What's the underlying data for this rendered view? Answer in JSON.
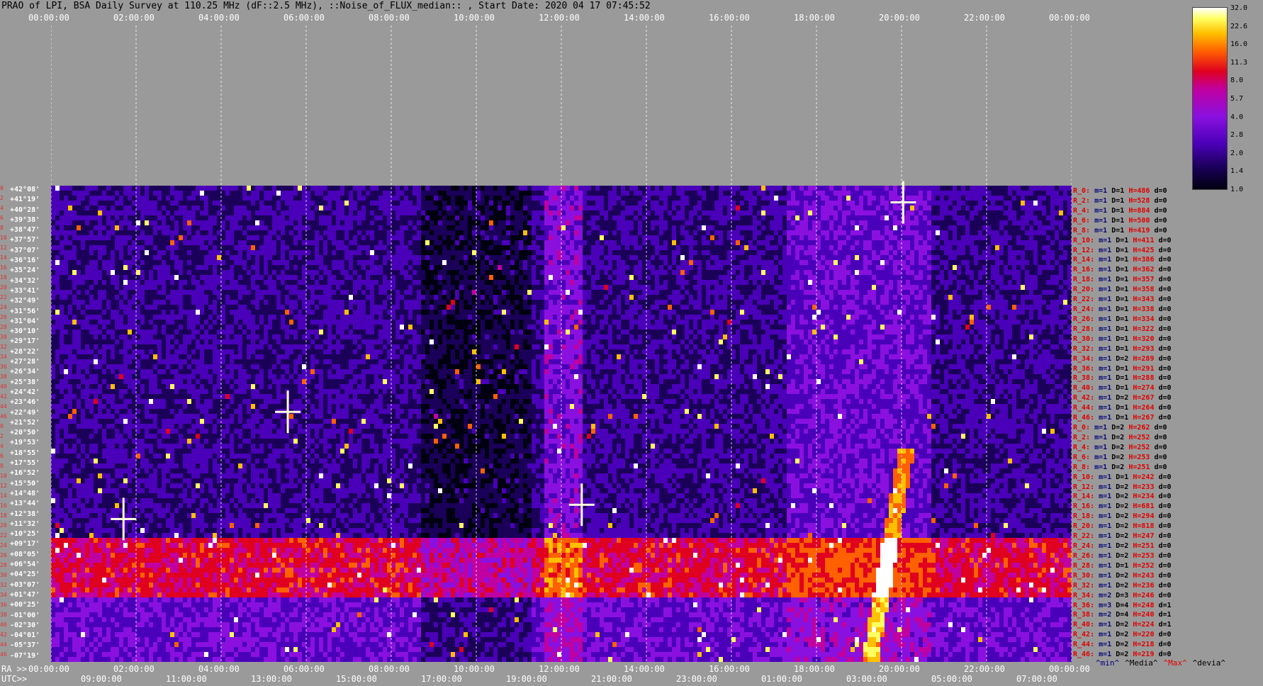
{
  "title": "PRAO of LPI, BSA Daily Survey at 110.25 MHz (dF::2.5 MHz), ::Noise_of_FLUX_median:: , Start Date: 2020 04 17 07:45:52",
  "top_axis_ticks": [
    "00:00:00",
    "02:00:00",
    "04:00:00",
    "06:00:00",
    "08:00:00",
    "10:00:00",
    "12:00:00",
    "14:00:00",
    "16:00:00",
    "18:00:00",
    "20:00:00",
    "22:00:00",
    "00:00:00"
  ],
  "bottom_ra_label": "RA >>",
  "bottom_ra_ticks": [
    "00:00:00",
    "02:00:00",
    "04:00:00",
    "06:00:00",
    "08:00:00",
    "10:00:00",
    "12:00:00",
    "14:00:00",
    "16:00:00",
    "18:00:00",
    "20:00:00",
    "22:00:00",
    "00:00:00"
  ],
  "bottom_utc_label": "UTC>>",
  "bottom_utc_ticks": [
    "09:00:00",
    "11:00:00",
    "13:00:00",
    "15:00:00",
    "17:00:00",
    "19:00:00",
    "21:00:00",
    "23:00:00",
    "01:00:00",
    "03:00:00",
    "05:00:00",
    "07:00:00"
  ],
  "dec_labels": [
    "+42°08'",
    "+41°19'",
    "+40°28'",
    "+39°38'",
    "+38°47'",
    "+37°57'",
    "+37°07'",
    "+36°16'",
    "+35°24'",
    "+34°32'",
    "+33°41'",
    "+32°49'",
    "+31°56'",
    "+31°04'",
    "+30°10'",
    "+29°17'",
    "+28°22'",
    "+27°28'",
    "+26°34'",
    "+25°38'",
    "+24°42'",
    "+23°46'",
    "+22°49'",
    "+21°52'",
    "+20°50'",
    "+19°53'",
    "+18°55'",
    "+17°55'",
    "+16°52'",
    "+15°50'",
    "+14°48'",
    "+13°44'",
    "+12°38'",
    "+11°32'",
    "+10°25'",
    "+09°17'",
    "+08°05'",
    "+06°54'",
    "+04°25'",
    "+03°07'",
    "+01°47'",
    "+00°25'",
    "-01°00'",
    "-02°30'",
    "-04°01'",
    "-05°37'",
    "-07°19'"
  ],
  "row_numbers": [
    "0",
    "2",
    "4",
    "6",
    "8",
    "10",
    "12",
    "14",
    "16",
    "18",
    "20",
    "22",
    "24",
    "26",
    "28",
    "30",
    "32",
    "34",
    "36",
    "38",
    "40",
    "42",
    "44",
    "46",
    "0",
    "2",
    "4",
    "6",
    "8",
    "10",
    "12",
    "14",
    "16",
    "18",
    "20",
    "22",
    "24",
    "26",
    "28",
    "30",
    "32",
    "34",
    "36",
    "38",
    "40",
    "42",
    "44",
    "46"
  ],
  "row_info": [
    {
      "r": "R_0:",
      "m": "1",
      "d": "1",
      "h": "486",
      "dv": "0"
    },
    {
      "r": "R_2:",
      "m": "1",
      "d": "1",
      "h": "528",
      "dv": "0"
    },
    {
      "r": "R_4:",
      "m": "1",
      "d": "1",
      "h": "884",
      "dv": "0"
    },
    {
      "r": "R_6:",
      "m": "1",
      "d": "1",
      "h": "500",
      "dv": "0"
    },
    {
      "r": "R_8:",
      "m": "1",
      "d": "1",
      "h": "419",
      "dv": "0"
    },
    {
      "r": "R_10:",
      "m": "1",
      "d": "1",
      "h": "411",
      "dv": "0"
    },
    {
      "r": "R_12:",
      "m": "1",
      "d": "1",
      "h": "425",
      "dv": "0"
    },
    {
      "r": "R_14:",
      "m": "1",
      "d": "1",
      "h": "386",
      "dv": "0"
    },
    {
      "r": "R_16:",
      "m": "1",
      "d": "1",
      "h": "362",
      "dv": "0"
    },
    {
      "r": "R_18:",
      "m": "1",
      "d": "1",
      "h": "357",
      "dv": "0"
    },
    {
      "r": "R_20:",
      "m": "1",
      "d": "1",
      "h": "358",
      "dv": "0"
    },
    {
      "r": "R_22:",
      "m": "1",
      "d": "1",
      "h": "343",
      "dv": "0"
    },
    {
      "r": "R_24:",
      "m": "1",
      "d": "1",
      "h": "338",
      "dv": "0"
    },
    {
      "r": "R_26:",
      "m": "1",
      "d": "1",
      "h": "334",
      "dv": "0"
    },
    {
      "r": "R_28:",
      "m": "1",
      "d": "1",
      "h": "322",
      "dv": "0"
    },
    {
      "r": "R_30:",
      "m": "1",
      "d": "1",
      "h": "320",
      "dv": "0"
    },
    {
      "r": "R_32:",
      "m": "1",
      "d": "1",
      "h": "293",
      "dv": "0"
    },
    {
      "r": "R_34:",
      "m": "1",
      "d": "2",
      "h": "289",
      "dv": "0"
    },
    {
      "r": "R_36:",
      "m": "1",
      "d": "1",
      "h": "291",
      "dv": "0"
    },
    {
      "r": "R_38:",
      "m": "1",
      "d": "1",
      "h": "288",
      "dv": "0"
    },
    {
      "r": "R_40:",
      "m": "1",
      "d": "1",
      "h": "274",
      "dv": "0"
    },
    {
      "r": "R_42:",
      "m": "1",
      "d": "2",
      "h": "267",
      "dv": "0"
    },
    {
      "r": "R_44:",
      "m": "1",
      "d": "1",
      "h": "264",
      "dv": "0"
    },
    {
      "r": "R_46:",
      "m": "1",
      "d": "1",
      "h": "267",
      "dv": "0"
    },
    {
      "r": "R_0:",
      "m": "1",
      "d": "2",
      "h": "262",
      "dv": "0"
    },
    {
      "r": "R_2:",
      "m": "1",
      "d": "2",
      "h": "252",
      "dv": "0"
    },
    {
      "r": "R_4:",
      "m": "1",
      "d": "2",
      "h": "252",
      "dv": "0"
    },
    {
      "r": "R_6:",
      "m": "1",
      "d": "2",
      "h": "253",
      "dv": "0"
    },
    {
      "r": "R_8:",
      "m": "1",
      "d": "2",
      "h": "251",
      "dv": "0"
    },
    {
      "r": "R_10:",
      "m": "1",
      "d": "1",
      "h": "242",
      "dv": "0"
    },
    {
      "r": "R_12:",
      "m": "1",
      "d": "2",
      "h": "233",
      "dv": "0"
    },
    {
      "r": "R_14:",
      "m": "1",
      "d": "2",
      "h": "234",
      "dv": "0"
    },
    {
      "r": "R_16:",
      "m": "1",
      "d": "2",
      "h": "681",
      "dv": "0"
    },
    {
      "r": "R_18:",
      "m": "1",
      "d": "2",
      "h": "294",
      "dv": "0"
    },
    {
      "r": "R_20:",
      "m": "1",
      "d": "2",
      "h": "818",
      "dv": "0"
    },
    {
      "r": "R_22:",
      "m": "1",
      "d": "2",
      "h": "247",
      "dv": "0"
    },
    {
      "r": "R_24:",
      "m": "1",
      "d": "2",
      "h": "251",
      "dv": "0"
    },
    {
      "r": "R_26:",
      "m": "1",
      "d": "2",
      "h": "253",
      "dv": "0"
    },
    {
      "r": "R_28:",
      "m": "1",
      "d": "1",
      "h": "252",
      "dv": "0"
    },
    {
      "r": "R_30:",
      "m": "1",
      "d": "2",
      "h": "243",
      "dv": "0"
    },
    {
      "r": "R_32:",
      "m": "1",
      "d": "2",
      "h": "236",
      "dv": "0"
    },
    {
      "r": "R_34:",
      "m": "2",
      "d": "3",
      "h": "246",
      "dv": "0"
    },
    {
      "r": "R_36:",
      "m": "3",
      "d": "4",
      "h": "248",
      "dv": "1"
    },
    {
      "r": "R_38:",
      "m": "2",
      "d": "4",
      "h": "240",
      "dv": "1"
    },
    {
      "r": "R_40:",
      "m": "1",
      "d": "2",
      "h": "224",
      "dv": "1"
    },
    {
      "r": "R_42:",
      "m": "1",
      "d": "2",
      "h": "220",
      "dv": "0"
    },
    {
      "r": "R_44:",
      "m": "1",
      "d": "2",
      "h": "218",
      "dv": "0"
    },
    {
      "r": "R_46:",
      "m": "1",
      "d": "2",
      "h": "219",
      "dv": "0"
    }
  ],
  "row_info_keys": {
    "m": "m=",
    "d": "D=",
    "h": "H=",
    "dv": "d="
  },
  "legend_stats": [
    {
      "label": "^min^",
      "color": "#000080"
    },
    {
      "label": "^Media^",
      "color": "#000000"
    },
    {
      "label": "^Max^",
      "color": "#e00000"
    },
    {
      "label": "^devia^",
      "color": "#000000"
    }
  ],
  "colorbar_ticks": [
    "32.0",
    "22.6",
    "16.0",
    "11.3",
    "8.0",
    "5.7",
    "4.0",
    "2.8",
    "2.0",
    "1.4",
    "1.0"
  ],
  "chart_data": {
    "type": "heatmap",
    "title": "PRAO of LPI, BSA Daily Survey at 110.25 MHz (dF::2.5 MHz), ::Noise_of_FLUX_median:: , Start Date: 2020 04 17 07:45:52",
    "x_axis": "RA 00:00:00 – 24:00:00",
    "y_axis": "Dec +42°08' – -07°19'",
    "colorbar_range": [
      1.0,
      32.0
    ],
    "colorbar_scale": "log",
    "colors": [
      "#000010",
      "#1a0058",
      "#4a00b8",
      "#8a10e0",
      "#c000a0",
      "#e00020",
      "#ff6000",
      "#ffc000",
      "#ffff60",
      "#ffffff"
    ]
  }
}
